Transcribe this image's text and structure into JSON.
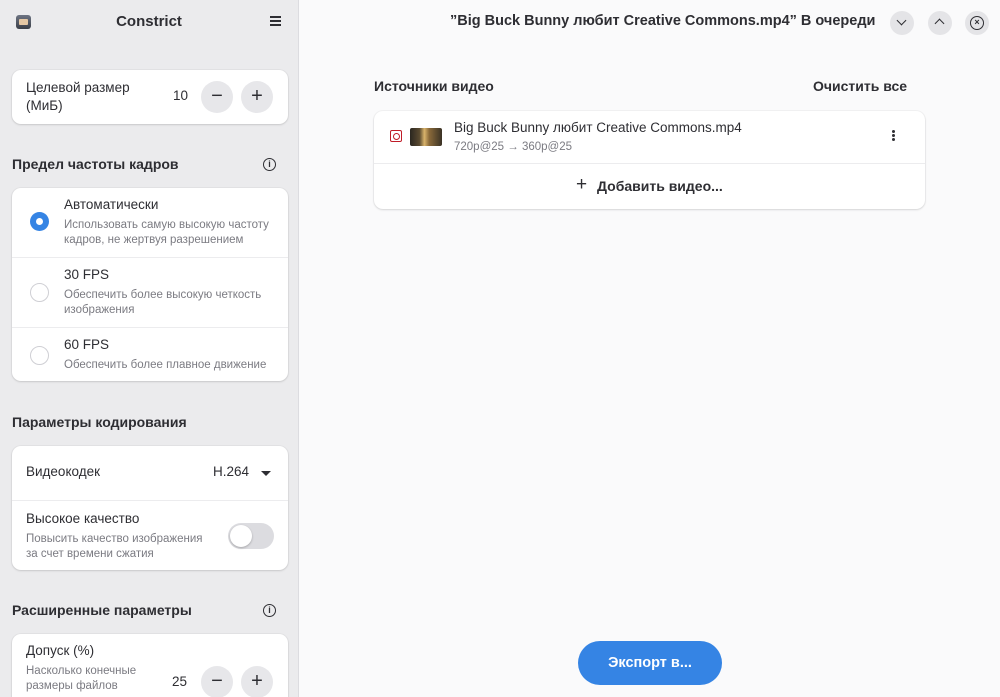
{
  "sidebar": {
    "title": "Constrict",
    "app_icon": "app-icon",
    "menu_icon": "hamburger-menu-icon",
    "target_size": {
      "label": "Целевой размер (МиБ)",
      "value": "10",
      "minus": "−",
      "plus": "+"
    },
    "framerate": {
      "title": "Предел частоты кадров",
      "options": [
        {
          "label": "Автоматически",
          "sub": "Использовать самую высокую частоту кадров, не жертвуя разрешением",
          "selected": true
        },
        {
          "label": "30 FPS",
          "sub": "Обеспечить более высокую четкость изображения",
          "selected": false
        },
        {
          "label": "60 FPS",
          "sub": "Обеспечить более плавное движение",
          "selected": false
        }
      ]
    },
    "encoding": {
      "title": "Параметры кодирования",
      "codec_label": "Видеокодек",
      "codec_value": "H.264",
      "quality_label": "Высокое качество",
      "quality_sub": "Повысить качество изображения за счет времени сжатия",
      "quality_on": false
    },
    "advanced": {
      "title": "Расширенные параметры",
      "tolerance_label": "Допуск (%)",
      "tolerance_sub": "Насколько конечные размеры файлов",
      "tolerance_value": "25",
      "minus": "−",
      "plus": "+"
    },
    "info_glyph": "i"
  },
  "header": {
    "title": "”Big Buck Bunny любит Creative Commons.mp4” В очереди",
    "close_glyph": "×"
  },
  "main": {
    "sources_label": "Источники видео",
    "clear_all": "Очистить все",
    "videos": [
      {
        "name": "Big Buck Bunny любит Creative Commons.mp4",
        "detail": "720p@25 → 360p@25"
      }
    ],
    "add_video_plus": "+",
    "add_video": "Добавить видео...",
    "export": "Экспорт в..."
  },
  "colors": {
    "accent": "#3584e4",
    "destructive": "#c01c28"
  }
}
